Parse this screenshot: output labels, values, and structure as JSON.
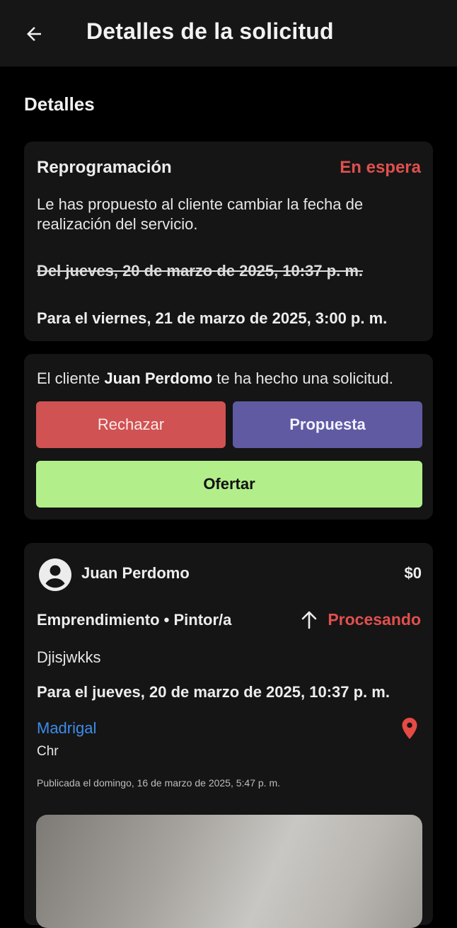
{
  "appbar": {
    "title": "Detalles de la solicitud",
    "back_icon": "arrow-left-icon"
  },
  "section_title": "Detalles",
  "reschedule": {
    "title": "Reprogramación",
    "status": "En espera",
    "status_color": "#e0504e",
    "message": "Le has propuesto al cliente cambiar la fecha de realización del servicio.",
    "old_date": "Del jueves, 20 de marzo de 2025, 10:37 p. m.",
    "new_date": "Para el viernes, 21 de marzo de 2025, 3:00 p. m."
  },
  "request": {
    "prefix": "El cliente ",
    "client": "Juan Perdomo",
    "suffix": " te ha hecho una solicitud.",
    "reject_label": "Rechazar",
    "propose_label": "Propuesta",
    "offer_label": "Ofertar",
    "reject_color": "#d05252",
    "propose_color": "#5f5aa2",
    "offer_color": "#b2ef8a"
  },
  "service": {
    "client_name": "Juan Perdomo",
    "price": "$0",
    "category": "Emprendimiento • Pintor/a",
    "status": "Procesando",
    "status_icon": "arrow-up-icon",
    "description": "Djisjwkks",
    "due_date": "Para el jueves, 20 de marzo de 2025, 10:37 p. m.",
    "location": "Madrigal",
    "location_sub": "Chr",
    "location_icon": "map-pin-icon",
    "published": "Publicada el domingo, 16 de marzo de 2025, 5:47 p. m.",
    "link_color": "#3d8ce8"
  }
}
